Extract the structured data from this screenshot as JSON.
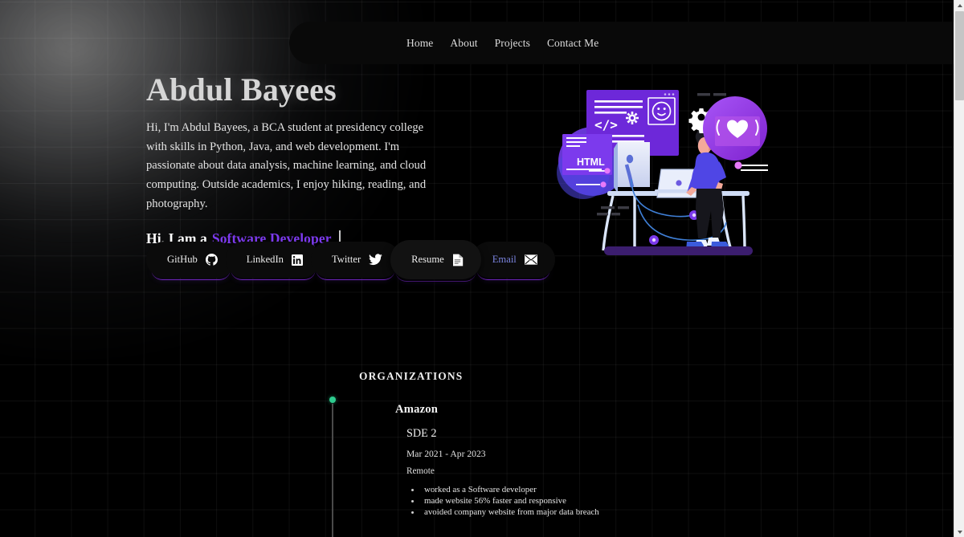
{
  "nav": {
    "items": [
      {
        "label": "Home",
        "name": "nav-link-home"
      },
      {
        "label": "About",
        "name": "nav-link-about"
      },
      {
        "label": "Projects",
        "name": "nav-link-projects"
      },
      {
        "label": "Contact Me",
        "name": "nav-link-contact-me"
      }
    ]
  },
  "hero": {
    "name": "Abdul Bayees",
    "bio": "Hi, I'm Abdul Bayees, a BCA student at presidency college with skills in Python, Java, and web development. I'm passionate about data analysis, machine learning, and cloud computing. Outside academics, I enjoy hiking, reading, and photography.",
    "role_prefix": "Hi, I am a",
    "role_accent": "Software Developer",
    "accent_color": "#7c3aed"
  },
  "socials": [
    {
      "label": "GitHub",
      "icon": "github-icon"
    },
    {
      "label": "LinkedIn",
      "icon": "linkedin-icon"
    },
    {
      "label": "Twitter",
      "icon": "twitter-icon"
    },
    {
      "label": "Resume",
      "icon": "document-icon"
    },
    {
      "label": "Email",
      "icon": "envelope-icon"
    }
  ],
  "illustration": {
    "name": "developer-at-desk-illustration",
    "html_label": "HTML",
    "code_glyph": "</>",
    "heart_glyph": "{ }"
  },
  "organizations": {
    "section_title": "ORGANIZATIONS",
    "entries": [
      {
        "company": "Amazon",
        "role": "SDE 2",
        "dates": "Mar 2021 - Apr 2023",
        "location": "Remote",
        "points": [
          "worked as a Software developer",
          "made website 56% faster and responsive",
          "avoided company website from major data breach"
        ],
        "marker_color": "#2ecc8f"
      }
    ]
  },
  "scrollbar": {
    "up_arrow": "scroll-up-arrow",
    "down_arrow": "scroll-down-arrow"
  }
}
